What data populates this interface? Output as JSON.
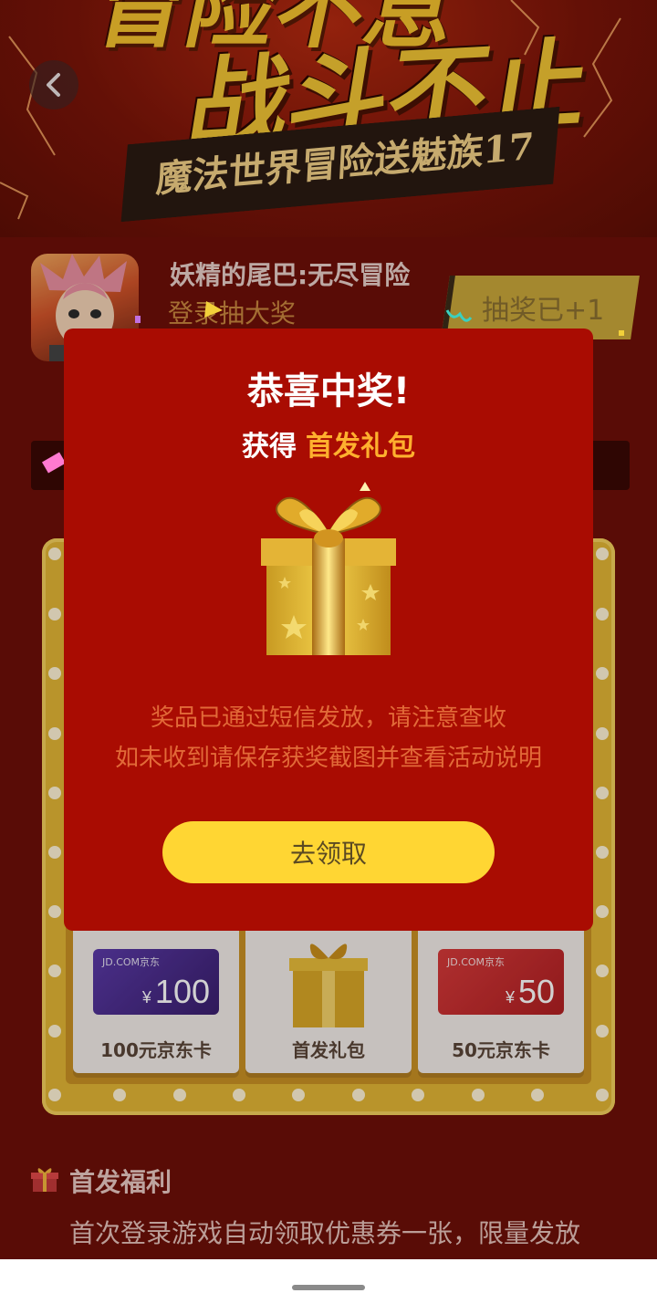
{
  "banner": {
    "line1": "冒险不息",
    "line2": "战斗不止",
    "subtitle": "魔法世界冒险送魅族17"
  },
  "game": {
    "name": "妖精的尾巴:无尽冒险",
    "subtitle": "登录抽大奖",
    "draw_badge": "抽奖已+1"
  },
  "prizes": [
    {
      "label": "100元京东卡",
      "brand": "JD.COM京东",
      "currency": "¥",
      "amount": "100",
      "color": "#4a2a8c"
    },
    {
      "label": "首发礼包"
    },
    {
      "label": "50元京东卡",
      "brand": "JD.COM京东",
      "currency": "¥",
      "amount": "50",
      "color": "#c92b2b"
    }
  ],
  "welfare": {
    "title": "首发福利",
    "description": "首次登录游戏自动领取优惠券一张，限量发放"
  },
  "modal": {
    "title": "恭喜中奖!",
    "subtitle_prefix": "获得",
    "prize_name": "首发礼包",
    "message_line1": "奖品已通过短信发放，请注意查收",
    "message_line2": "如未收到请保存获奖截图并查看活动说明",
    "button_label": "去领取"
  },
  "colors": {
    "modal_bg": "#a90c02",
    "accent_orange": "#ffb02e",
    "button_yellow": "#ffd633",
    "message_text": "#e26a38",
    "page_bg": "#6d0f08",
    "board_gold": "#e2b535"
  },
  "icons": {
    "back": "chevron-left-icon",
    "gift": "gift-box-icon",
    "welfare": "gift-icon"
  }
}
